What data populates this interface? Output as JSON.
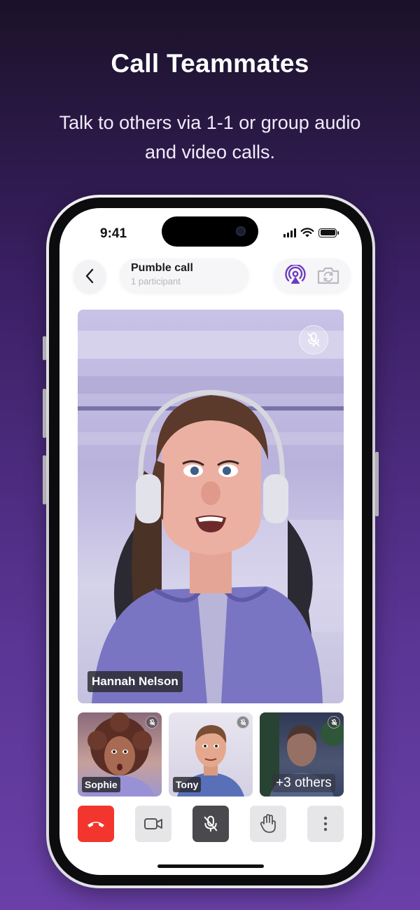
{
  "promo": {
    "headline": "Call Teammates",
    "subline": "Talk to others via 1-1 or group audio and video calls."
  },
  "status_bar": {
    "time": "9:41"
  },
  "call_header": {
    "title": "Pumble call",
    "participants": "1 participant",
    "icons": [
      "back-chevron-icon",
      "airplay-audio-icon",
      "switch-camera-icon"
    ]
  },
  "main_video": {
    "name": "Hannah Nelson",
    "muted": true
  },
  "thumbnails": [
    {
      "name": "Sophie",
      "muted": true
    },
    {
      "name": "Tony",
      "muted": true
    },
    {
      "name": "+3 others",
      "muted": true
    }
  ],
  "controls": {
    "items": [
      "hang-up-icon",
      "camera-icon",
      "mic-off-icon",
      "raise-hand-icon",
      "more-icon"
    ],
    "hangup_color": "#f2362d",
    "active_dark": "#4a4a4e"
  },
  "colors": {
    "accent": "#6c3bbf",
    "bg_top": "#1a1228",
    "bg_bottom": "#6a40a8"
  }
}
